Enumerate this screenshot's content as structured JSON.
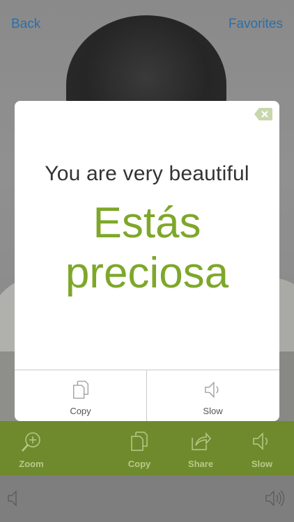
{
  "nav": {
    "back_label": "Back",
    "favorites_label": "Favorites"
  },
  "phrase": {
    "english": "You are very beautiful",
    "spanish": "Estás preciosa"
  },
  "modal_actions": {
    "copy_label": "Copy",
    "slow_label": "Slow"
  },
  "toolbar": {
    "zoom_label": "Zoom",
    "copy_label": "Copy",
    "share_label": "Share",
    "slow_label": "Slow"
  },
  "icons": {
    "close": "close-icon",
    "copy": "copy-icon",
    "speaker": "speaker-icon",
    "zoom": "zoom-in-icon",
    "share": "share-icon"
  },
  "colors": {
    "accent_green": "#7ea72a",
    "toolbar_green": "#6f8a2d",
    "link_blue": "#2d6ea8"
  }
}
